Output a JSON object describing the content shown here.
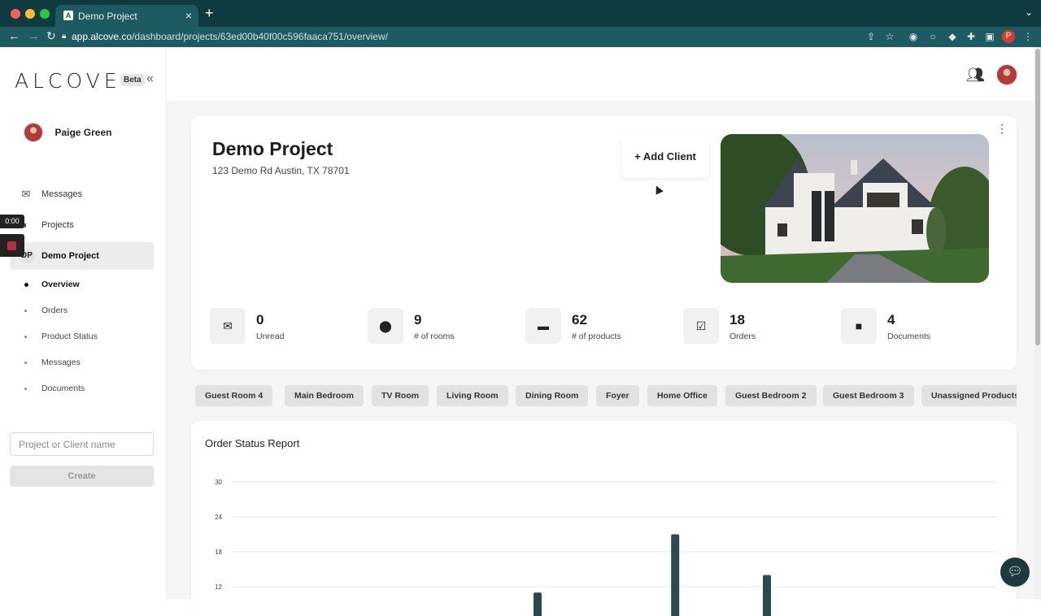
{
  "browser": {
    "tab_title": "Demo Project",
    "tab_favicon_letter": "A",
    "url_host": "app.alcove.co",
    "url_path": "/dashboard/projects/63ed00b40f00c596faaca751/overview/",
    "profile_letter": "P",
    "traffic_colors": [
      "#ff5f57",
      "#febc2e",
      "#28c840"
    ]
  },
  "sidebar": {
    "logo": "ALCOVE",
    "beta_label": "Beta",
    "user_name": "Paige Green",
    "nav": [
      {
        "label": "Messages",
        "icon": "mail-icon"
      },
      {
        "label": "Projects",
        "icon": "palette-icon"
      },
      {
        "label": "Demo Project",
        "badge": "DP"
      }
    ],
    "sub_items": [
      "Overview",
      "Orders",
      "Product Status",
      "Messages",
      "Documents"
    ],
    "search_placeholder": "Project or Client name",
    "create_label": "Create",
    "recorder_time": "0:00"
  },
  "project": {
    "title": "Demo Project",
    "address": "123 Demo Rd Austin, TX 78701",
    "add_client_label": "+ Add Client",
    "stats": [
      {
        "value": "0",
        "label": "Unread",
        "icon": "envelope-icon"
      },
      {
        "value": "9",
        "label": "# of rooms",
        "icon": "location-pin-icon"
      },
      {
        "value": "62",
        "label": "# of products",
        "icon": "sofa-icon"
      },
      {
        "value": "18",
        "label": "Orders",
        "icon": "document-check-icon"
      },
      {
        "value": "4",
        "label": "Documents",
        "icon": "folder-icon"
      }
    ]
  },
  "rooms": [
    "Guest Room 4",
    "Main Bedroom",
    "TV Room",
    "Living Room",
    "Dining Room",
    "Foyer",
    "Home Office",
    "Guest Bedroom 2",
    "Guest Bedroom 3",
    "Unassigned Products"
  ],
  "report": {
    "title": "Order Status Report"
  },
  "chart_data": {
    "type": "bar",
    "title": "Order Status Report",
    "y_ticks": [
      30,
      24,
      18,
      12
    ],
    "ylim": [
      0,
      30
    ],
    "grid": true,
    "bar_color": "#2c4a4d",
    "bars": [
      {
        "position": 0.4,
        "value": 11
      },
      {
        "position": 0.58,
        "value": 21
      },
      {
        "position": 0.7,
        "value": 14
      }
    ]
  }
}
